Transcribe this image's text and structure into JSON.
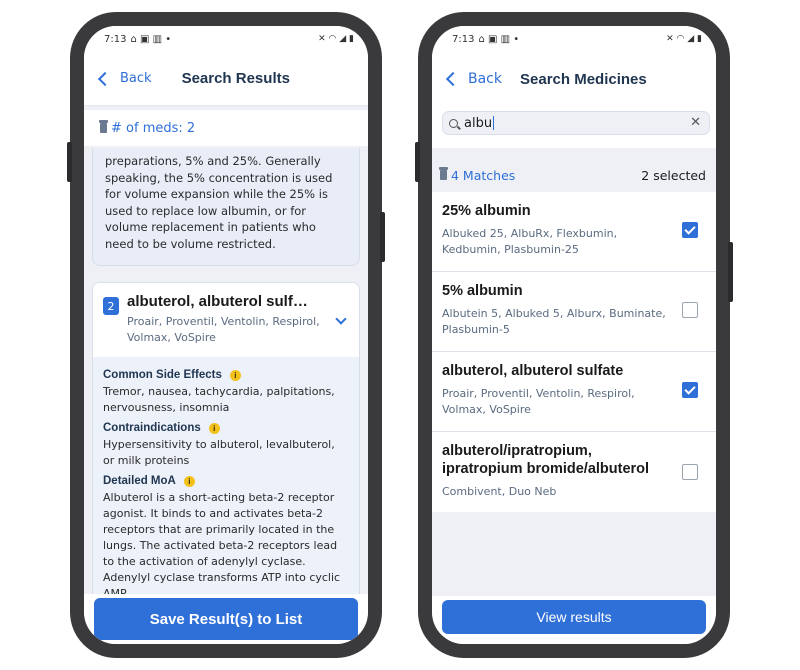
{
  "status": {
    "time": "7:13"
  },
  "left": {
    "nav": {
      "back_label": "Back",
      "title": "Search Results"
    },
    "meds_count": "# of meds: 2",
    "description": "preparations, 5% and 25%. Generally speaking, the 5% concentration is used for volume expansion while the 25% is used to replace low albumin, or for volume replacement in patients who need to be volume restricted.",
    "med": {
      "number": "2",
      "title": "albuterol, albuterol sulf…",
      "brands": "Proair, Proventil, Ventolin, Respirol, Volmax, VoSpire",
      "sections": [
        {
          "title": "Common Side Effects",
          "text": "Tremor, nausea, tachycardia, palpitations, nervousness, insomnia"
        },
        {
          "title": "Contraindications",
          "text": "Hypersensitivity to albuterol, levalbuterol, or milk proteins"
        },
        {
          "title": "Detailed MoA",
          "text": "Albuterol is a short-acting beta-2 receptor agonist. It binds to and activates beta-2 receptors that are primarily located in the lungs. The activated beta-2 receptors lead to the activation of adenylyl cyclase. Adenylyl cyclase transforms ATP into cyclic AMP."
        }
      ]
    },
    "save_button": "Save Result(s) to List"
  },
  "right": {
    "nav": {
      "back_label": "Back",
      "title": "Search Medicines"
    },
    "search": {
      "value": "albu"
    },
    "matches": "4 Matches",
    "selected": "2 selected",
    "results": [
      {
        "title": "25% albumin",
        "brands": "Albuked 25, AlbuRx, Flexbumin, Kedbumin, Plasbumin-25",
        "checked": true
      },
      {
        "title": "5% albumin",
        "brands": "Albutein 5, Albuked 5, Alburx, Buminate, Plasbumin-5",
        "checked": false
      },
      {
        "title": "albuterol, albuterol sulfate",
        "brands": "Proair, Proventil, Ventolin, Respirol, Volmax, VoSpire",
        "checked": true
      },
      {
        "title": "albuterol/ipratropium, ipratropium bromide/albuterol",
        "brands": "Combivent, Duo Neb",
        "checked": false
      }
    ],
    "view_button": "View results"
  },
  "colors": {
    "accent": "#2f6fd8",
    "card_bg": "#e8edf8",
    "info": "#f2c21b",
    "frame": "#3a3a3c"
  },
  "icons": [
    "back-chevron-icon",
    "bottle-icon",
    "info-icon",
    "chevron-down-icon",
    "search-icon",
    "clear-icon",
    "checkbox-icon"
  ]
}
